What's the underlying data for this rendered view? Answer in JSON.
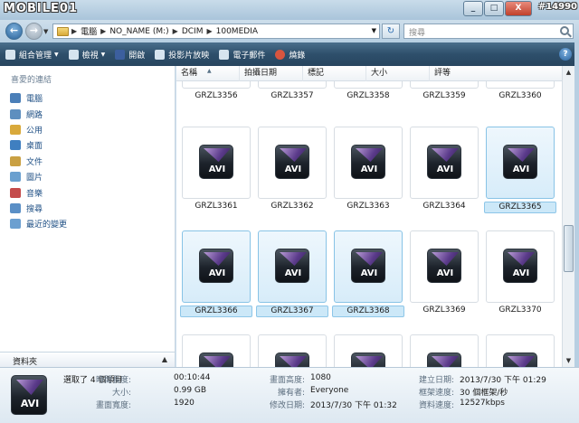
{
  "window": {
    "logo": "MOBILE01",
    "watermark": "#14990",
    "buttons": [
      "_",
      "□",
      "X"
    ]
  },
  "address": {
    "crumbs": [
      "電腦",
      "NO_NAME (M:)",
      "DCIM",
      "100MEDIA"
    ],
    "search_placeholder": "搜尋"
  },
  "toolbar": {
    "items": [
      "組合管理",
      "檢視",
      "開啟",
      "投影片放映",
      "電子郵件",
      "燒錄"
    ]
  },
  "navpane": {
    "heading": "喜愛的連結",
    "links": [
      "電腦",
      "網路",
      "公用",
      "桌面",
      "文件",
      "圖片",
      "音樂",
      "搜尋",
      "最近的變更"
    ],
    "folders_label": "資料夾",
    "icon_colors": [
      "#4b7fb8",
      "#5e8fbf",
      "#d9a93b",
      "#3f7fc0",
      "#c9a043",
      "#6aa0cf",
      "#c44b4b",
      "#5a8fc6",
      "#6b9fd0"
    ]
  },
  "columns": [
    "名稱",
    "拍攝日期",
    "標記",
    "大小",
    "評等"
  ],
  "files": [
    {
      "name": "GRZL3356",
      "selected": false
    },
    {
      "name": "GRZL3357",
      "selected": false
    },
    {
      "name": "GRZL3358",
      "selected": false
    },
    {
      "name": "GRZL3359",
      "selected": false
    },
    {
      "name": "GRZL3360",
      "selected": false
    },
    {
      "name": "GRZL3361",
      "selected": false
    },
    {
      "name": "GRZL3362",
      "selected": false
    },
    {
      "name": "GRZL3363",
      "selected": false
    },
    {
      "name": "GRZL3364",
      "selected": false
    },
    {
      "name": "GRZL3365",
      "selected": true
    },
    {
      "name": "GRZL3366",
      "selected": true
    },
    {
      "name": "GRZL3367",
      "selected": true
    },
    {
      "name": "GRZL3368",
      "selected": true
    },
    {
      "name": "GRZL3369",
      "selected": false
    },
    {
      "name": "GRZL3370",
      "selected": false
    },
    {
      "name": "",
      "selected": false
    },
    {
      "name": "",
      "selected": false
    },
    {
      "name": "",
      "selected": false
    },
    {
      "name": "",
      "selected": false
    },
    {
      "name": "",
      "selected": false
    }
  ],
  "file_badge": "AVI",
  "details": {
    "selection": "選取了 4 個項目",
    "fields": [
      {
        "label": "時間長度:",
        "value": "00:10:44"
      },
      {
        "label": "大小:",
        "value": "0.99 GB"
      },
      {
        "label": "畫面寬度:",
        "value": "1920"
      },
      {
        "label": "畫面高度:",
        "value": "1080"
      },
      {
        "label": "擁有者:",
        "value": "Everyone"
      },
      {
        "label": "修改日期:",
        "value": "2013/7/30 下午 01:32"
      },
      {
        "label": "建立日期:",
        "value": "2013/7/30 下午 01:29"
      },
      {
        "label": "框架速度:",
        "value": "30 個框架/秒"
      },
      {
        "label": "資料速度:",
        "value": "12527kbps"
      }
    ]
  }
}
